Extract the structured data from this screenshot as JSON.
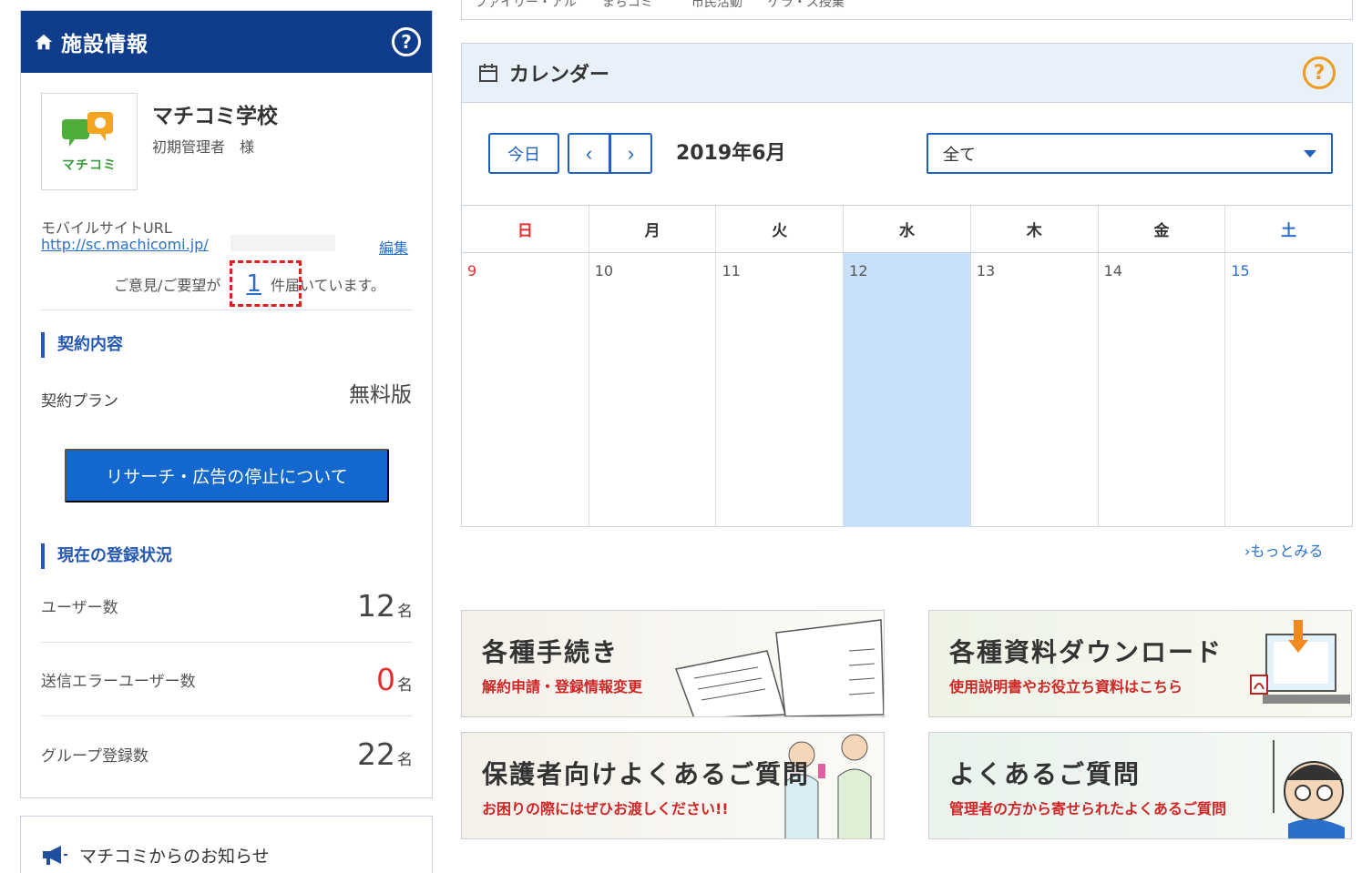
{
  "facility": {
    "title": "施設情報",
    "school_name": "マチコミ学校",
    "admin_name": "初期管理者　様",
    "logo_text": "マチコミ",
    "mobile_label": "モバイルサイトURL",
    "mobile_url": "http://sc.machicomi.jp/",
    "edit_label": "編集",
    "opinion_prefix": "ご意見/ご要望が",
    "opinion_count": "1",
    "opinion_suffix": "件届いています。",
    "contract": {
      "heading": "契約内容",
      "plan_label": "契約プラン",
      "plan_value": "無料版",
      "stop_button": "リサーチ・広告の停止について"
    },
    "registration": {
      "heading": "現在の登録状況",
      "unit": "名",
      "users_label": "ユーザー数",
      "users_value": "12",
      "errors_label": "送信エラーユーザー数",
      "errors_value": "0",
      "groups_label": "グループ登録数",
      "groups_value": "22"
    }
  },
  "notice": {
    "title": "マチコミからのお知らせ"
  },
  "top_cut_text": "ファイリー・アル　　まちコミ　　　市民活動　　ゲラ・ス授業",
  "calendar": {
    "title": "カレンダー",
    "today_button": "今日",
    "prev_label": "‹",
    "next_label": "›",
    "month": "2019年6月",
    "filter_value": "全て",
    "weekdays": [
      "日",
      "月",
      "火",
      "水",
      "木",
      "金",
      "土"
    ],
    "days": [
      "9",
      "10",
      "11",
      "12",
      "13",
      "14",
      "15"
    ],
    "today": "12",
    "more_link": "›もっとみる"
  },
  "banners": {
    "procedures": {
      "title": "各種手続き",
      "subtitle": "解約申請・登録情報変更"
    },
    "downloads": {
      "title": "各種資料ダウンロード",
      "subtitle": "使用説明書やお役立ち資料はこちら"
    },
    "parents_faq": {
      "title": "保護者向けよくあるご質問",
      "subtitle": "お困りの際にはぜひお渡しください!!"
    },
    "faq": {
      "title": "よくあるご質問",
      "subtitle": "管理者の方から寄せられたよくあるご質問"
    }
  },
  "colors": {
    "header_navy": "#0f3d8c",
    "accent_blue": "#1268cf",
    "link_blue": "#2a6fc9",
    "today_highlight": "#c8e0fa",
    "sunday_red": "#e03030",
    "help_orange": "#f09a20"
  },
  "icons": [
    "home-icon",
    "help-icon",
    "calendar-icon",
    "megaphone-icon",
    "chevron-left-icon",
    "chevron-right-icon",
    "caret-down-icon",
    "pdf-icon"
  ]
}
